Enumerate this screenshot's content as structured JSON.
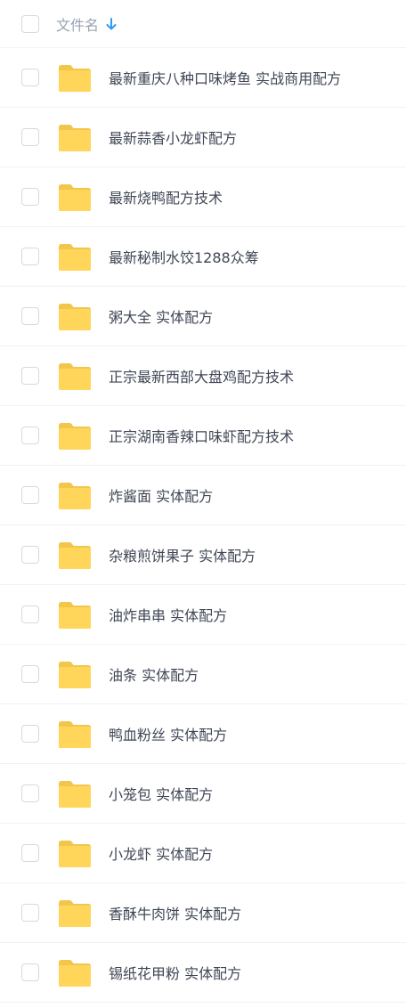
{
  "header": {
    "title": "文件名",
    "sort_icon": "arrow-down-icon",
    "sort_color": "#2f9bf4"
  },
  "folder_color": "#ffd659",
  "files": [
    {
      "name": "最新重庆八种口味烤鱼 实战商用配方"
    },
    {
      "name": "最新蒜香小龙虾配方"
    },
    {
      "name": "最新烧鸭配方技术"
    },
    {
      "name": "最新秘制水饺1288众筹"
    },
    {
      "name": "粥大全 实体配方"
    },
    {
      "name": "正宗最新西部大盘鸡配方技术"
    },
    {
      "name": "正宗湖南香辣口味虾配方技术"
    },
    {
      "name": "炸酱面 实体配方"
    },
    {
      "name": "杂粮煎饼果子 实体配方"
    },
    {
      "name": "油炸串串 实体配方"
    },
    {
      "name": "油条 实体配方"
    },
    {
      "name": "鸭血粉丝 实体配方"
    },
    {
      "name": "小笼包 实体配方"
    },
    {
      "name": "小龙虾 实体配方"
    },
    {
      "name": "香酥牛肉饼 实体配方"
    },
    {
      "name": "锡纸花甲粉 实体配方"
    }
  ]
}
